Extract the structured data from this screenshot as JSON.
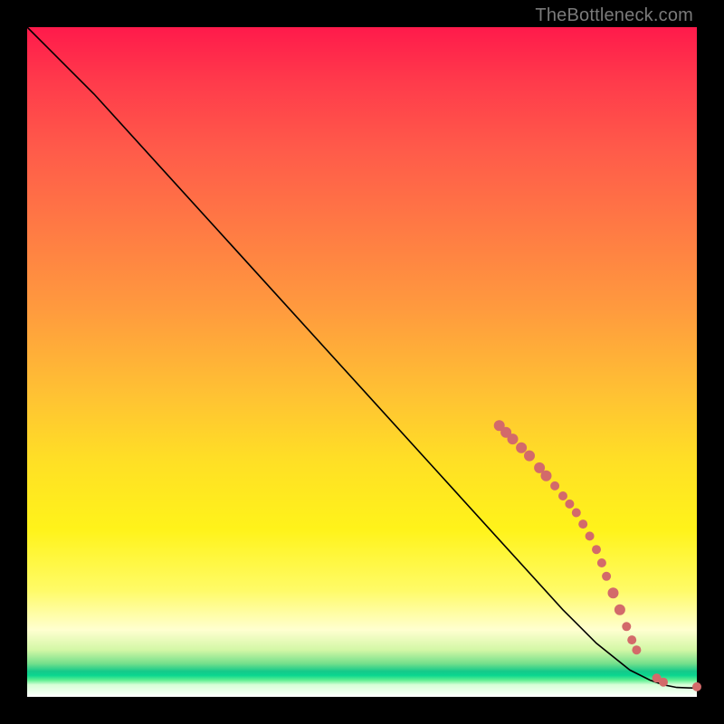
{
  "attribution": "TheBottleneck.com",
  "colors": {
    "marker": "#d36a6a",
    "curve": "#000000"
  },
  "chart_data": {
    "type": "line",
    "title": "",
    "xlabel": "",
    "ylabel": "",
    "xlim": [
      0,
      100
    ],
    "ylim": [
      0,
      100
    ],
    "grid": false,
    "legend": false,
    "series": [
      {
        "name": "curve",
        "x": [
          0,
          3,
          6,
          10,
          20,
          30,
          40,
          50,
          60,
          70,
          80,
          85,
          90,
          93,
          95,
          97,
          100
        ],
        "y": [
          100,
          97,
          94,
          90,
          79,
          68,
          57,
          46,
          35,
          24,
          13,
          8,
          4,
          2.5,
          1.8,
          1.4,
          1.3
        ]
      }
    ],
    "markers": [
      {
        "x": 70.5,
        "y": 40.5,
        "r": 6
      },
      {
        "x": 71.5,
        "y": 39.5,
        "r": 6
      },
      {
        "x": 72.5,
        "y": 38.5,
        "r": 6
      },
      {
        "x": 73.8,
        "y": 37.2,
        "r": 6
      },
      {
        "x": 75.0,
        "y": 36.0,
        "r": 6
      },
      {
        "x": 76.5,
        "y": 34.2,
        "r": 6
      },
      {
        "x": 77.5,
        "y": 33.0,
        "r": 6
      },
      {
        "x": 78.8,
        "y": 31.5,
        "r": 5
      },
      {
        "x": 80.0,
        "y": 30.0,
        "r": 5
      },
      {
        "x": 81.0,
        "y": 28.8,
        "r": 5
      },
      {
        "x": 82.0,
        "y": 27.5,
        "r": 5
      },
      {
        "x": 83.0,
        "y": 25.8,
        "r": 5
      },
      {
        "x": 84.0,
        "y": 24.0,
        "r": 5
      },
      {
        "x": 85.0,
        "y": 22.0,
        "r": 5
      },
      {
        "x": 85.8,
        "y": 20.0,
        "r": 5
      },
      {
        "x": 86.5,
        "y": 18.0,
        "r": 5
      },
      {
        "x": 87.5,
        "y": 15.5,
        "r": 6
      },
      {
        "x": 88.5,
        "y": 13.0,
        "r": 6
      },
      {
        "x": 89.5,
        "y": 10.5,
        "r": 5
      },
      {
        "x": 90.3,
        "y": 8.5,
        "r": 5
      },
      {
        "x": 91.0,
        "y": 7.0,
        "r": 5
      },
      {
        "x": 94.0,
        "y": 2.8,
        "r": 5
      },
      {
        "x": 95.0,
        "y": 2.2,
        "r": 5
      },
      {
        "x": 100.0,
        "y": 1.5,
        "r": 5
      }
    ]
  }
}
